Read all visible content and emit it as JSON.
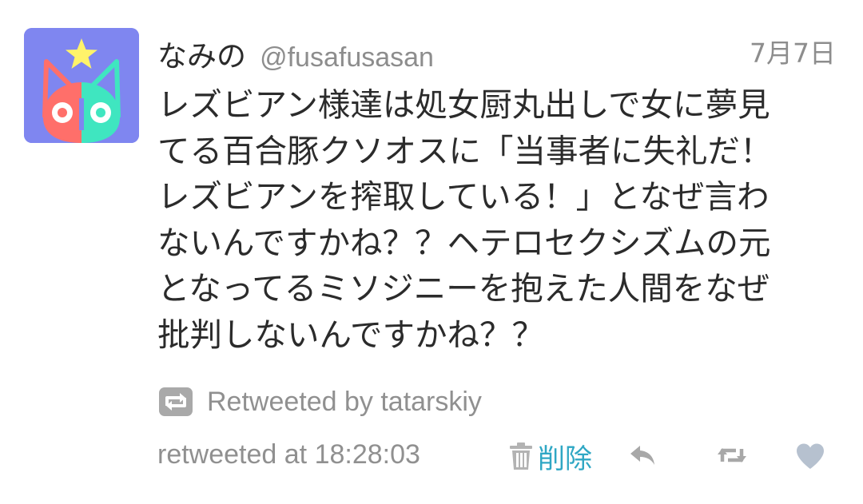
{
  "tweet": {
    "display_name": "なみの",
    "handle": "@fusafusasan",
    "date": "7月7日",
    "text_lines": [
      "レズビアン様達は処女厨丸出しで女に夢見",
      "てる百合豚クソオスに「当事者に失礼だ！",
      "レズビアンを搾取している！」となぜ言わ",
      "ないんですかね？？ヘテロセクシズムの元",
      "となってるミソジニーを抱えた人間をなぜ",
      "批判しないんですかね？？"
    ],
    "retweeted_by": "Retweeted by tatarskiy",
    "retweeted_at": "retweeted at 18:28:03",
    "delete_label": "削除"
  },
  "icons": {
    "avatar": "cat-avatar-icon",
    "retweet_indicator": "retweet-icon",
    "delete": "trash-icon",
    "reply": "reply-icon",
    "retweet": "retweet-icon",
    "like": "heart-icon"
  },
  "colors": {
    "avatar_bg": "#7f86f0",
    "name_text": "#2b2b2b",
    "meta_text": "#8d8d8d",
    "delete_text": "#2fa7c4",
    "icon_gray": "#a8a8a8",
    "heart": "#b6c1cf"
  }
}
